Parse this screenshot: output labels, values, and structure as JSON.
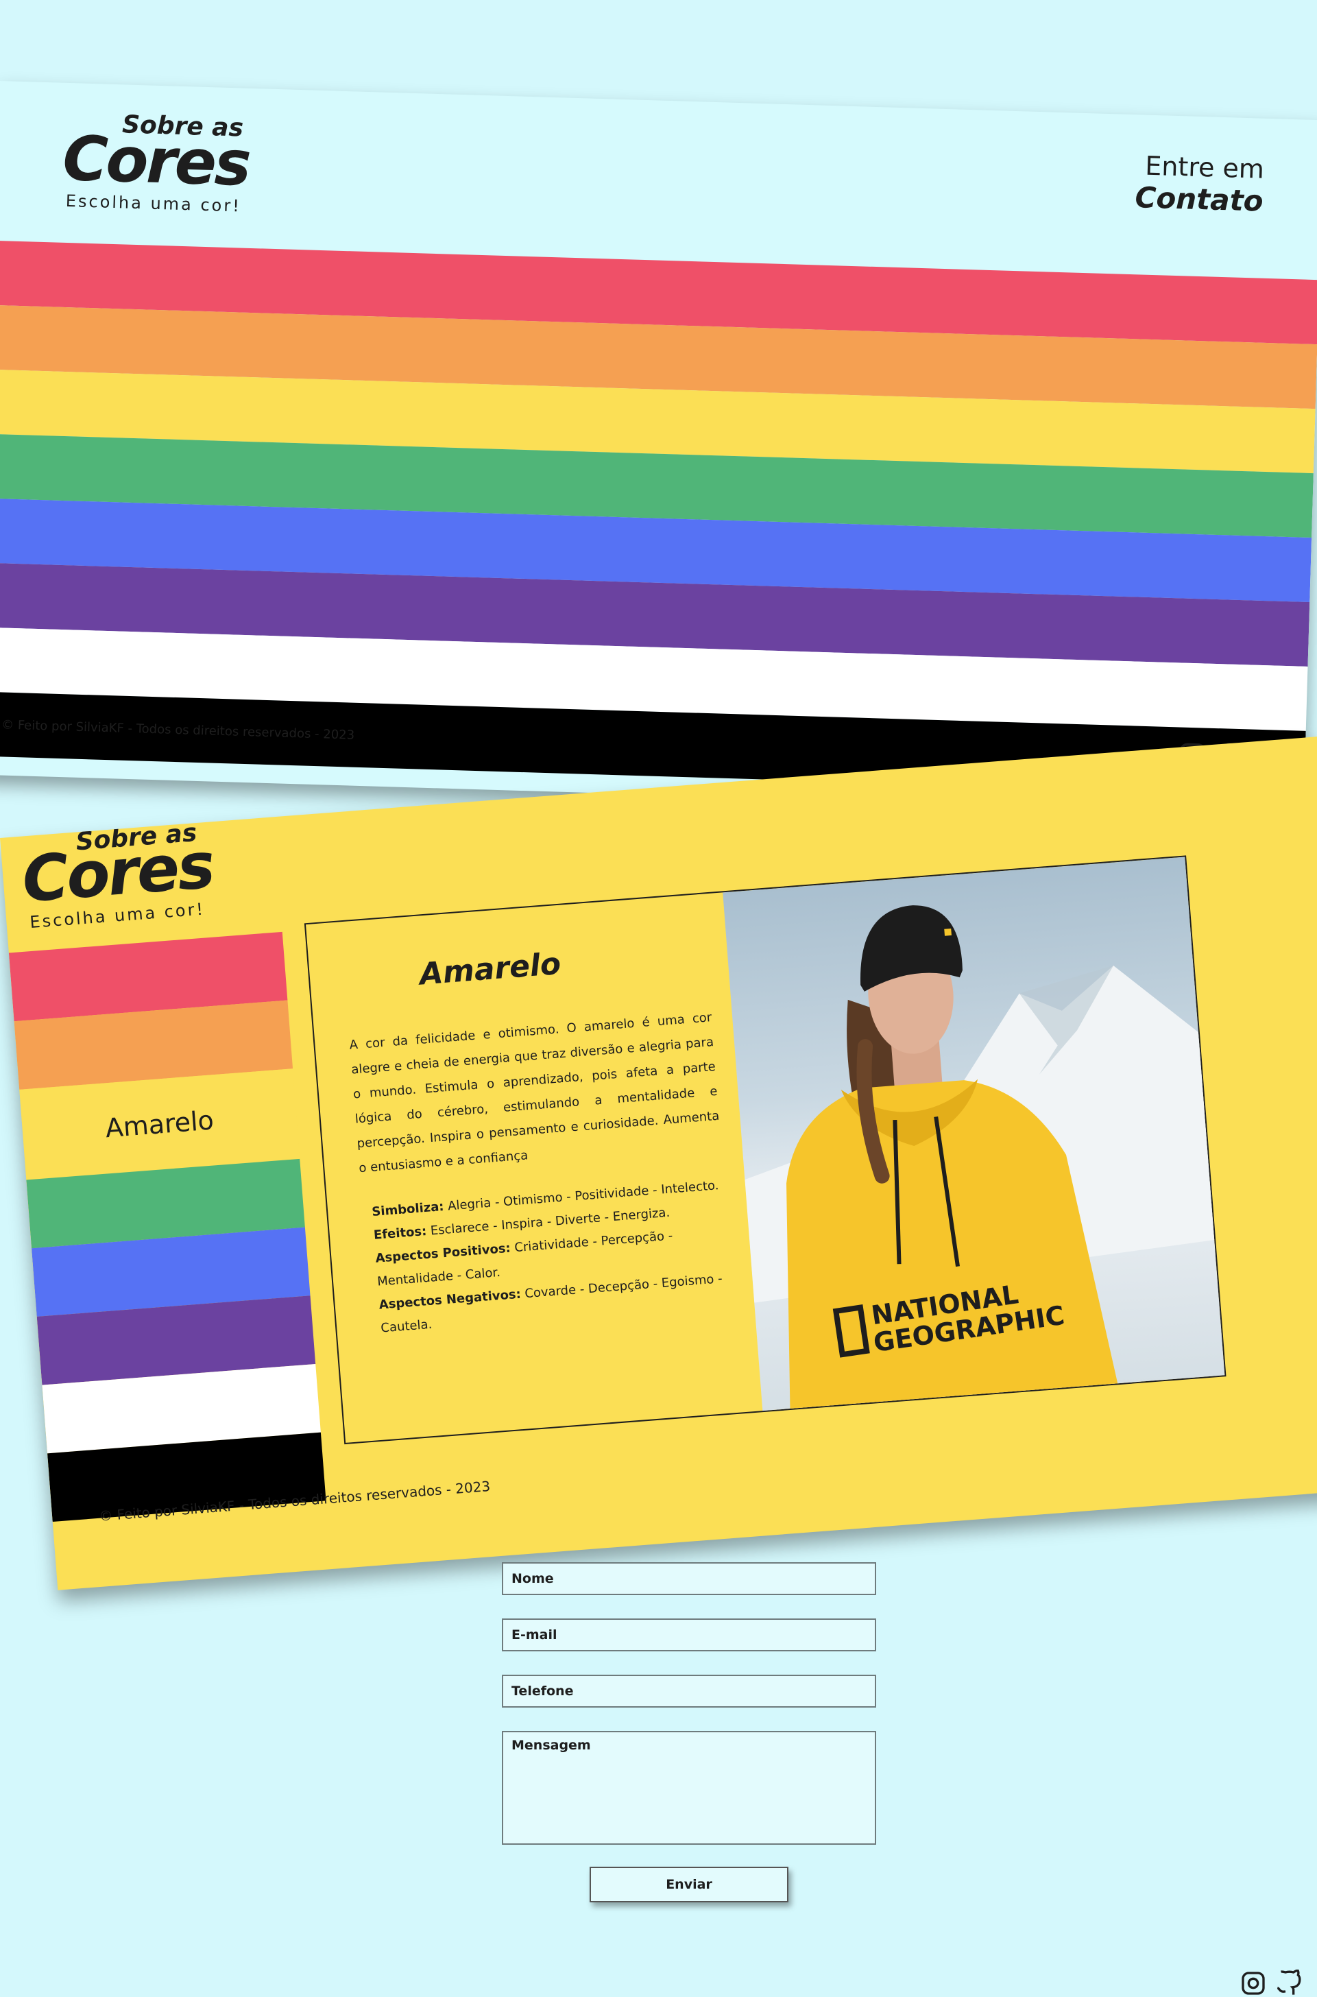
{
  "colors": {
    "page_bg": "#d4f8fc",
    "red": "#ef5068",
    "orange": "#f5a052",
    "yellow": "#fbdf55",
    "green": "#50b578",
    "blue": "#5672f4",
    "purple": "#6b42a0",
    "white": "#ffffff",
    "black": "#000000"
  },
  "home": {
    "logo": {
      "small": "Sobre as",
      "big": "Cores",
      "tagline": "Escolha uma cor!"
    },
    "contact": {
      "line1": "Entre em",
      "line2": "Contato"
    },
    "stripes": [
      {
        "name": "vermelho",
        "color": "#ef5068"
      },
      {
        "name": "laranja",
        "color": "#f5a052"
      },
      {
        "name": "amarelo",
        "color": "#fbdf55"
      },
      {
        "name": "verde",
        "color": "#50b578"
      },
      {
        "name": "azul",
        "color": "#5672f4"
      },
      {
        "name": "roxo",
        "color": "#6b42a0"
      },
      {
        "name": "branco",
        "color": "#ffffff"
      },
      {
        "name": "preto",
        "color": "#000000"
      }
    ],
    "footer": "© Feito por SilviaKF - Todos os direitos reservados - 2023",
    "icons": [
      "instagram-icon",
      "github-icon"
    ]
  },
  "amarelo_page": {
    "logo": {
      "small": "Sobre as",
      "big": "Cores",
      "tagline": "Escolha uma cor!"
    },
    "active_label": "Amarelo",
    "title": "Amarelo",
    "description": "A cor da felicidade e otimismo. O amarelo é uma cor alegre e cheia de energia que traz diversão e alegria para o mundo. Estimula o aprendizado, pois afeta a parte lógica do cérebro, estimulando a mentalidade e percepção. Inspira o pensamento e curiosidade. Aumenta o entusiasmo e a confiança",
    "attributes": [
      {
        "label": "Simboliza:",
        "value": "Alegria - Otimismo - Positividade - Intelecto."
      },
      {
        "label": "Efeitos:",
        "value": "Esclarece - Inspira - Diverte - Energiza."
      },
      {
        "label": "Aspectos Positivos:",
        "value": "Criatividade - Percepção - Mentalidade - Calor."
      },
      {
        "label": "Aspectos Negativos:",
        "value": "Covarde - Decepção - Egoismo - Cautela."
      }
    ],
    "photo_text": {
      "line1": "NATIONAL",
      "line2": "GEOGRAPHIC"
    },
    "footer": "© Feito por SilviaKF - Todos os direitos reservados - 2023"
  },
  "form": {
    "name_placeholder": "Nome",
    "email_placeholder": "E-mail",
    "phone_placeholder": "Telefone",
    "message_placeholder": "Mensagem",
    "submit_label": "Enviar"
  }
}
